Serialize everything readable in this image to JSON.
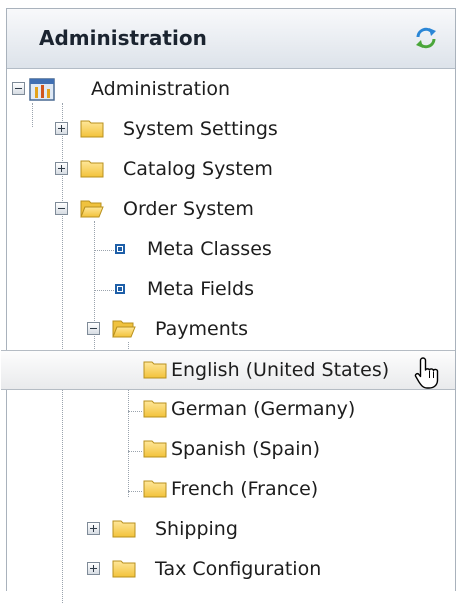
{
  "panel": {
    "title": "Administration"
  },
  "icons": {
    "refresh": "refresh-icon",
    "root": "administration-tree-icon",
    "folder": "folder-icon",
    "folder_open": "folder-open-icon",
    "leaf": "bullet-icon",
    "cursor": "hand-cursor-icon"
  },
  "colors": {
    "folder": "#f5cd4e",
    "bullet": "#1e5fa8",
    "selected_border": "#b5bcc4"
  },
  "tree": {
    "root": {
      "label": "Administration",
      "expanded": true
    },
    "system_settings": {
      "label": "System Settings",
      "expanded": false
    },
    "catalog_system": {
      "label": "Catalog System",
      "expanded": false
    },
    "order_system": {
      "label": "Order System",
      "expanded": true
    },
    "meta_classes": {
      "label": "Meta Classes"
    },
    "meta_fields": {
      "label": "Meta Fields"
    },
    "payments": {
      "label": "Payments",
      "expanded": true
    },
    "english": {
      "label": "English (United States)",
      "selected": true
    },
    "german": {
      "label": "German (Germany)"
    },
    "spanish": {
      "label": "Spanish (Spain)"
    },
    "french": {
      "label": "French (France)"
    },
    "shipping": {
      "label": "Shipping",
      "expanded": false
    },
    "tax_configuration": {
      "label": "Tax Configuration",
      "expanded": false
    }
  }
}
